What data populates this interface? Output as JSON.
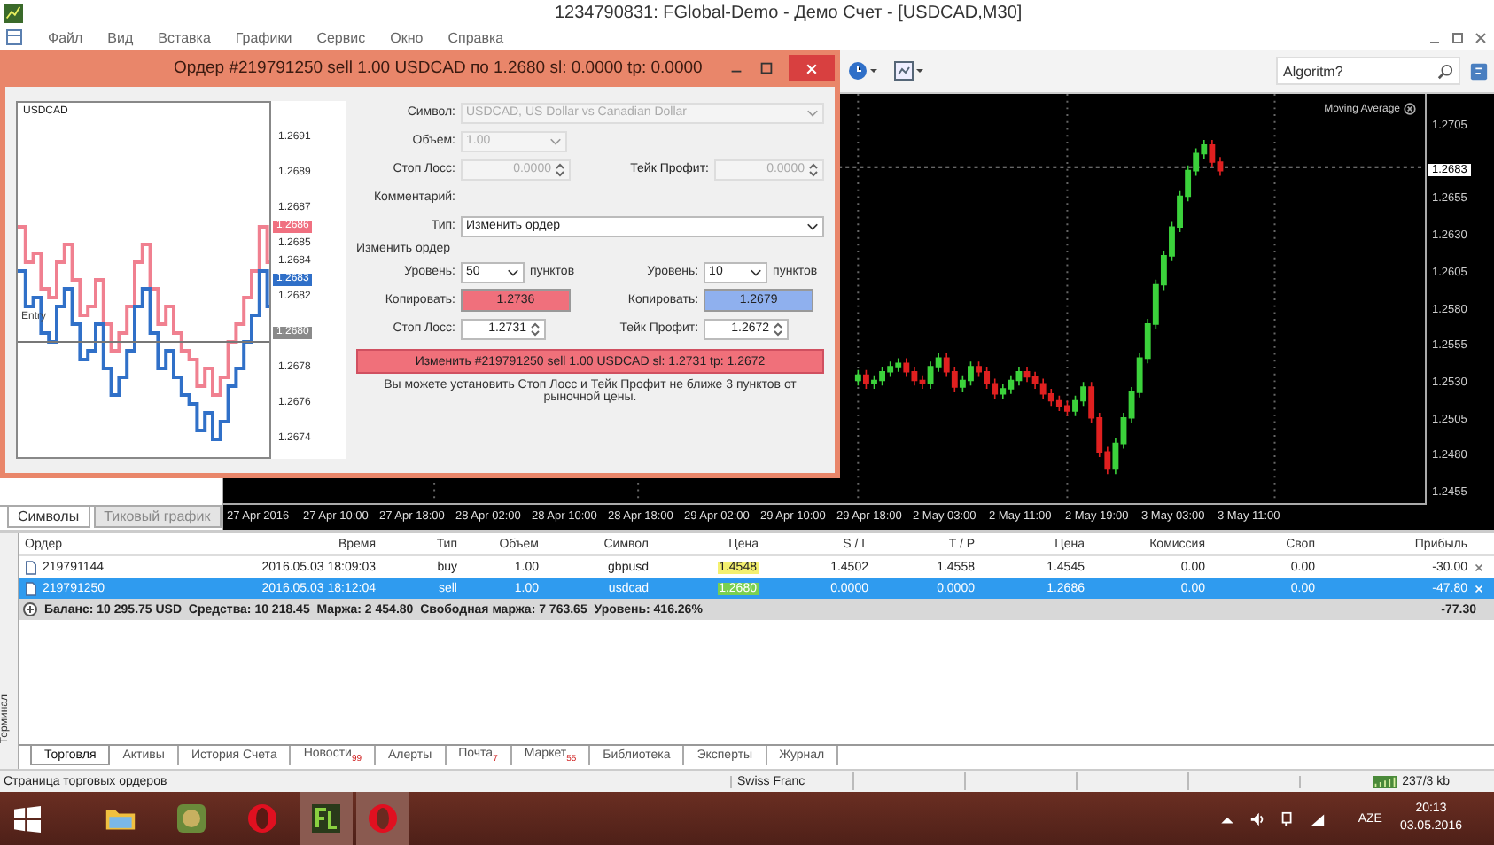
{
  "window": {
    "title": "1234790831: FGlobal-Demo - Демо Счет - [USDCAD,M30]",
    "menu": [
      "Файл",
      "Вид",
      "Вставка",
      "Графики",
      "Сервис",
      "Окно",
      "Справка"
    ]
  },
  "toolbar": {
    "search": {
      "value": "Algoritm?"
    }
  },
  "market_watch": {
    "tabs": [
      {
        "label": "Символы",
        "selected": true
      },
      {
        "label": "Тиковый график",
        "selected": false
      }
    ]
  },
  "chart": {
    "indicator": "Moving Average",
    "current_price": "1.2683",
    "price_labels": [
      "1.2705",
      "1.2655",
      "1.2630",
      "1.2605",
      "1.2580",
      "1.2555",
      "1.2530",
      "1.2505",
      "1.2480",
      "1.2455"
    ],
    "time_labels": [
      "27 Apr 2016",
      "27 Apr 10:00",
      "27 Apr 18:00",
      "28 Apr 02:00",
      "28 Apr 10:00",
      "28 Apr 18:00",
      "29 Apr 02:00",
      "29 Apr 10:00",
      "29 Apr 18:00",
      "2 May 03:00",
      "2 May 11:00",
      "2 May 19:00",
      "3 May 03:00",
      "3 May 11:00"
    ]
  },
  "dialog": {
    "title": "Ордер #219791250 sell 1.00 USDCAD по 1.2680 sl: 0.0000 tp: 0.0000",
    "mini_chart": {
      "symbol": "USDCAD",
      "entry_label": "Entry",
      "price_labels": [
        "1.2691",
        "1.2689",
        "1.2687",
        "1.2685",
        "1.2684",
        "1.2682",
        "1.2678",
        "1.2676",
        "1.2674"
      ],
      "markers": [
        {
          "text": "1.2686",
          "color": "#f07080"
        },
        {
          "text": "1.2683",
          "color": "#2f6fc8"
        },
        {
          "text": "1.2680",
          "color": "#8a8a8a"
        }
      ]
    },
    "symbol": {
      "label": "Символ:",
      "value": "USDCAD, US Dollar vs Canadian Dollar",
      "disabled": true
    },
    "volume": {
      "label": "Объем:",
      "value": "1.00",
      "disabled": true
    },
    "stop_loss": {
      "label": "Стоп Лосс:",
      "value": "0.0000",
      "disabled": true
    },
    "take_profit": {
      "label": "Тейк Профит:",
      "value": "0.0000",
      "disabled": true
    },
    "comment": {
      "label": "Комментарий:"
    },
    "type": {
      "label": "Тип:",
      "value": "Изменить ордер"
    },
    "section_title": "Изменить ордер",
    "levels": [
      {
        "label": "Уровень:",
        "value": "50",
        "unit": "пунктов",
        "copy_label": "Копировать:",
        "copy_value": "1.2736",
        "color": "#f0707c",
        "price_label": "Стоп Лосс:",
        "price_value": "1.2731"
      },
      {
        "label": "Уровень:",
        "value": "10",
        "unit": "пунктов",
        "copy_label": "Копировать:",
        "copy_value": "1.2679",
        "color": "#8fb0ee",
        "price_label": "Тейк Профит:",
        "price_value": "1.2672"
      }
    ],
    "modify_button": "Изменить #219791250 sell 1.00 USDCAD sl: 1.2731 tp: 1.2672",
    "note": "Вы можете установить Стоп Лосс и Тейк Профит не ближе 3 пунктов от рыночной цены."
  },
  "terminal": {
    "side_label": "Терминал",
    "columns": [
      "Ордер",
      "Время",
      "Тип",
      "Объем",
      "Символ",
      "Цена",
      "S / L",
      "T / P",
      "Цена",
      "Комиссия",
      "Своп",
      "Прибыль"
    ],
    "rows": [
      {
        "cells": [
          "219791144",
          "2016.05.03 18:09:03",
          "buy",
          "1.00",
          "gbpusd",
          "1.4548",
          "1.4502",
          "1.4558",
          "1.4545",
          "0.00",
          "0.00",
          "-30.00"
        ],
        "selected": false
      },
      {
        "cells": [
          "219791250",
          "2016.05.03 18:12:04",
          "sell",
          "1.00",
          "usdcad",
          "1.2680",
          "0.0000",
          "0.0000",
          "1.2686",
          "0.00",
          "0.00",
          "-47.80"
        ],
        "selected": true
      }
    ],
    "summary": "Баланс: 10 295.75 USD  Средства: 10 218.45  Маржа: 2 454.80  Свободная маржа: 7 763.65  Уровень: 416.26%",
    "total": "-77.30",
    "tabs": [
      {
        "label": "Торговля",
        "selected": true
      },
      {
        "label": "Активы",
        "selected": false
      },
      {
        "label": "История Счета",
        "selected": false
      },
      {
        "label": "Новости",
        "badge": "99",
        "selected": false
      },
      {
        "label": "Алерты",
        "selected": false
      },
      {
        "label": "Почта",
        "badge": "7",
        "selected": false
      },
      {
        "label": "Маркет",
        "badge": "55",
        "selected": false
      },
      {
        "label": "Библиотека",
        "selected": false
      },
      {
        "label": "Эксперты",
        "selected": false
      },
      {
        "label": "Журнал",
        "selected": false
      }
    ]
  },
  "status_bar": {
    "message": "Страница торговых ордеров",
    "symbol": "Swiss Franc",
    "traffic": "237/3 kb"
  },
  "taskbar": {
    "language": "AZE",
    "time": "20:13",
    "date": "03.05.2016"
  }
}
